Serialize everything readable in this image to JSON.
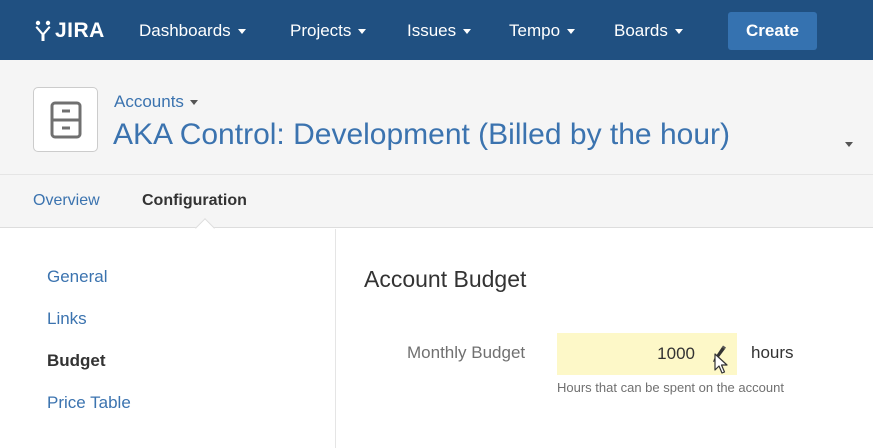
{
  "topnav": {
    "logo": "JIRA",
    "items": [
      {
        "label": "Dashboards"
      },
      {
        "label": "Projects"
      },
      {
        "label": "Issues"
      },
      {
        "label": "Tempo"
      },
      {
        "label": "Boards"
      }
    ],
    "create_label": "Create"
  },
  "header": {
    "breadcrumb": "Accounts",
    "title": "AKA Control: Development (Billed by the hour)"
  },
  "tabs": [
    {
      "label": "Overview"
    },
    {
      "label": "Configuration"
    }
  ],
  "sidebar": {
    "items": [
      {
        "label": "General"
      },
      {
        "label": "Links"
      },
      {
        "label": "Budget"
      },
      {
        "label": "Price Table"
      }
    ]
  },
  "main": {
    "section_title": "Account Budget",
    "field_label": "Monthly Budget",
    "field_value": "1000",
    "unit": "hours",
    "help_text": "Hours that can be spent on the account"
  },
  "colors": {
    "topbar": "#205081",
    "create_button": "#3572b0",
    "link": "#3b73af",
    "input_highlight": "#fdf8c8"
  }
}
